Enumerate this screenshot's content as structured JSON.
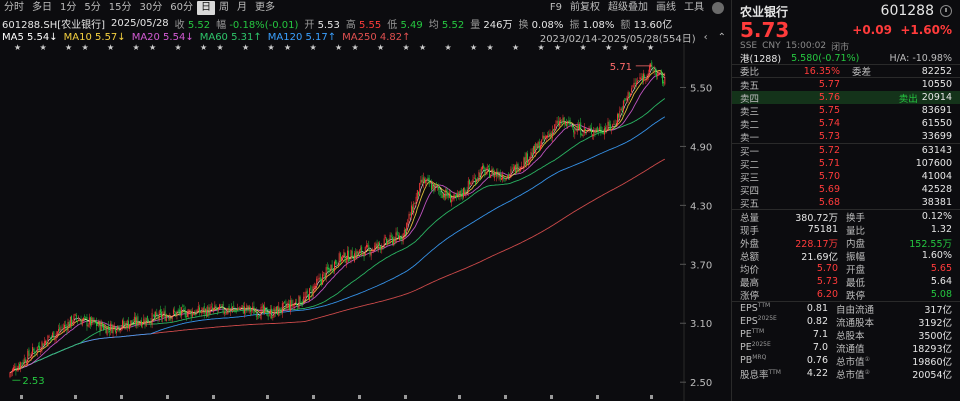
{
  "toolbar": {
    "periods": [
      "分时",
      "多日",
      "1分",
      "5分",
      "15分",
      "30分",
      "60分",
      "日",
      "周",
      "月",
      "更多"
    ],
    "active_index": 7,
    "right": [
      "F9",
      "前复权",
      "超级叠加",
      "画线",
      "工具"
    ]
  },
  "info": {
    "code": "601288.SH[农业银行]",
    "date": "2025/05/28",
    "close_label": "收",
    "close": "5.52",
    "change_label": "幅",
    "change": "-0.18%(-0.01)",
    "open_label": "开",
    "open": "5.53",
    "high_label": "高",
    "high": "5.55",
    "low_label": "低",
    "low": "5.49",
    "avg_label": "均",
    "avg": "5.52",
    "volume_label": "量",
    "volume": "246万",
    "turnover_label": "换",
    "turnover": "0.08%",
    "amplitude_label": "振",
    "amplitude": "1.08%",
    "amount_label": "额",
    "amount": "13.60亿"
  },
  "ma": {
    "ma5": "MA5 5.54↓",
    "ma10": "MA10 5.57↓",
    "ma20": "MA20 5.54↓",
    "ma60": "MA60 5.31↑",
    "ma120": "MA120 5.17↑",
    "ma250": "MA250 4.82↑",
    "range": "2023/02/14-2025/05/28(554日)"
  },
  "chart_data": {
    "type": "candlestick",
    "y_ticks": [
      "5.50",
      "4.90",
      "4.30",
      "3.70",
      "3.10",
      "2.50"
    ],
    "ylim": [
      2.4,
      5.8
    ],
    "high_marker": "5.71",
    "low_marker": "2.53",
    "colors": {
      "up": "#ff3b3b",
      "down": "#25c740",
      "ma5": "#ffffff",
      "ma10": "#f4d03f",
      "ma20": "#d35bd3",
      "ma60": "#2ec46a",
      "ma120": "#3aa0ff",
      "ma250": "#e05050"
    }
  },
  "panel": {
    "name": "农业银行",
    "code": "601288",
    "price": "5.73",
    "change": "+0.09",
    "change_pct": "+1.60%",
    "meta": [
      "SSE",
      "CNY",
      "15:00:02",
      "闭市"
    ],
    "hk_label": "港(1288)",
    "hk_value": "5.580(-0.71%)",
    "ha": "H/A: -10.98%",
    "weibi_label": "委比",
    "weibi": "16.35%",
    "weicha_label": "委差",
    "weicha": "82252",
    "asks": [
      {
        "label": "卖五",
        "price": "5.77",
        "vol": "10550"
      },
      {
        "label": "卖四",
        "price": "5.76",
        "vol": "20914",
        "tag": "卖出"
      },
      {
        "label": "卖三",
        "price": "5.75",
        "vol": "83691"
      },
      {
        "label": "卖二",
        "price": "5.74",
        "vol": "61550"
      },
      {
        "label": "卖一",
        "price": "5.73",
        "vol": "33699"
      }
    ],
    "bids": [
      {
        "label": "买一",
        "price": "5.72",
        "vol": "63143"
      },
      {
        "label": "买二",
        "price": "5.71",
        "vol": "107600"
      },
      {
        "label": "买三",
        "price": "5.70",
        "vol": "41004"
      },
      {
        "label": "买四",
        "price": "5.69",
        "vol": "42528"
      },
      {
        "label": "买五",
        "price": "5.68",
        "vol": "38381"
      }
    ],
    "stats": [
      {
        "l1": "总量",
        "v1": "380.72万",
        "c1": "white",
        "l2": "换手",
        "v2": "0.12%",
        "c2": "white"
      },
      {
        "l1": "现手",
        "v1": "75181",
        "c1": "white",
        "l2": "量比",
        "v2": "1.32",
        "c2": "white"
      },
      {
        "l1": "外盘",
        "v1": "228.17万",
        "c1": "red",
        "l2": "内盘",
        "v2": "152.55万",
        "c2": "green"
      },
      {
        "l1": "总额",
        "v1": "21.69亿",
        "c1": "white",
        "l2": "振幅",
        "v2": "1.60%",
        "c2": "white"
      },
      {
        "l1": "均价",
        "v1": "5.70",
        "c1": "red",
        "l2": "开盘",
        "v2": "5.65",
        "c2": "red"
      },
      {
        "l1": "最高",
        "v1": "5.73",
        "c1": "red",
        "l2": "最低",
        "v2": "5.64",
        "c2": "white"
      },
      {
        "l1": "涨停",
        "v1": "6.20",
        "c1": "red",
        "l2": "跌停",
        "v2": "5.08",
        "c2": "green"
      }
    ],
    "fundamentals": [
      {
        "l1": "EPS",
        "s1": "TTM",
        "v1": "0.81",
        "l2": "自由流通",
        "v2": "317亿"
      },
      {
        "l1": "EPS",
        "s1": "2025E",
        "v1": "0.82",
        "l2": "流通股本",
        "v2": "3192亿"
      },
      {
        "l1": "PE",
        "s1": "TTM",
        "v1": "7.1",
        "l2": "总股本",
        "v2": "3500亿"
      },
      {
        "l1": "PE",
        "s1": "2025E",
        "v1": "7.0",
        "l2": "流通值",
        "v2": "18293亿"
      },
      {
        "l1": "PB",
        "s1": "MRQ",
        "v1": "0.76",
        "l2": "总市值",
        "s2": "①",
        "v2": "19860亿"
      },
      {
        "l1": "股息率",
        "s1": "TTM",
        "v1": "4.22",
        "l2": "总市值",
        "s2": "②",
        "v2": "20054亿"
      }
    ]
  }
}
